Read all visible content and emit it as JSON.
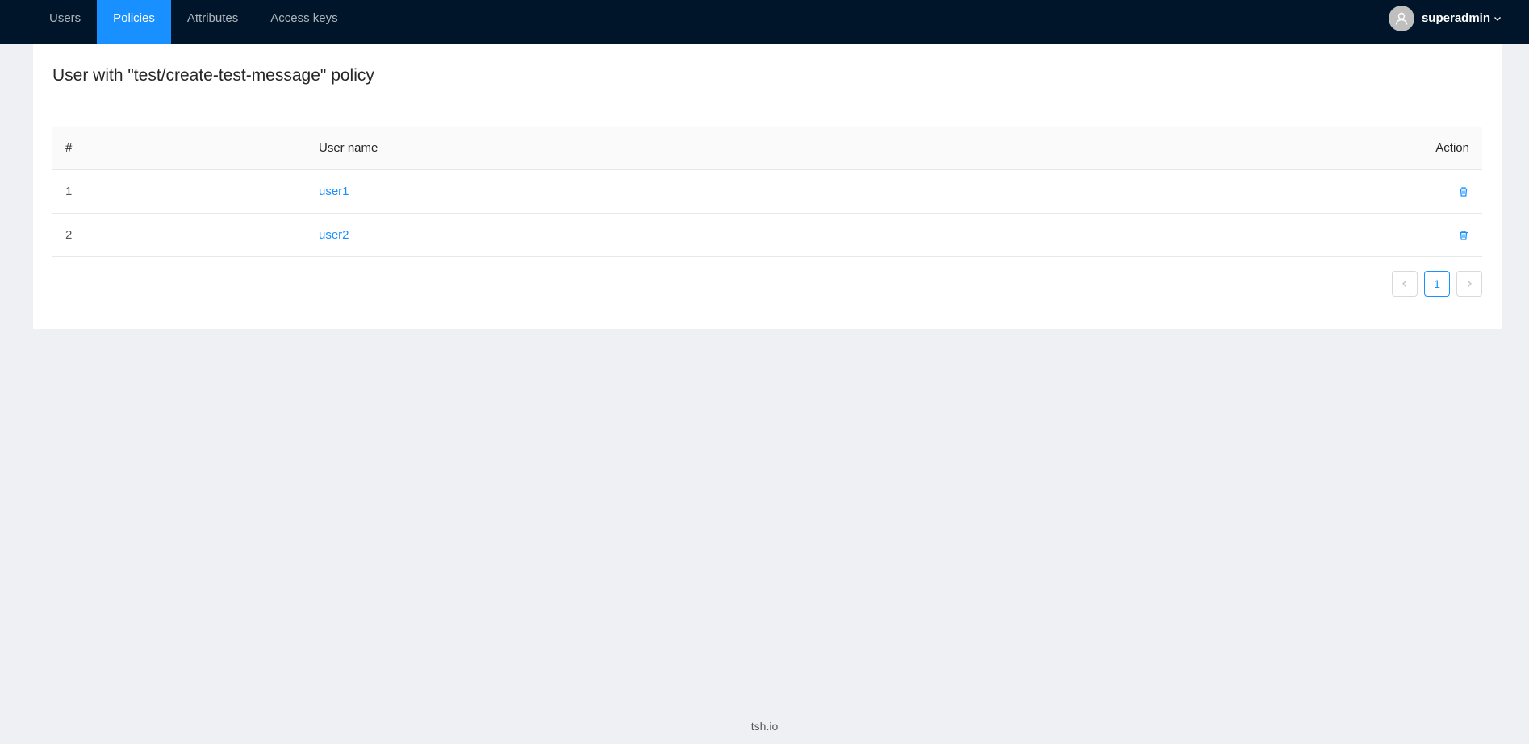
{
  "nav": {
    "items": [
      {
        "label": "Users"
      },
      {
        "label": "Policies"
      },
      {
        "label": "Attributes"
      },
      {
        "label": "Access keys"
      }
    ],
    "active_index": 1
  },
  "user_menu": {
    "username": "superadmin",
    "avatar_icon": "user-icon",
    "dropdown_icon": "chevron-down-icon"
  },
  "page": {
    "title": "User with \"test/create-test-message\" policy"
  },
  "table": {
    "columns": [
      "#",
      "User name",
      "Action"
    ],
    "rows": [
      {
        "index": "1",
        "user_name": "user1",
        "action_icon": "delete-icon"
      },
      {
        "index": "2",
        "user_name": "user2",
        "action_icon": "delete-icon"
      }
    ]
  },
  "pagination": {
    "current_page": "1",
    "prev_icon": "chevron-left-icon",
    "next_icon": "chevron-right-icon"
  },
  "footer": {
    "text": "tsh.io"
  },
  "colors": {
    "nav_bg": "#001529",
    "accent": "#1890ff",
    "page_bg": "#eef0f4"
  }
}
